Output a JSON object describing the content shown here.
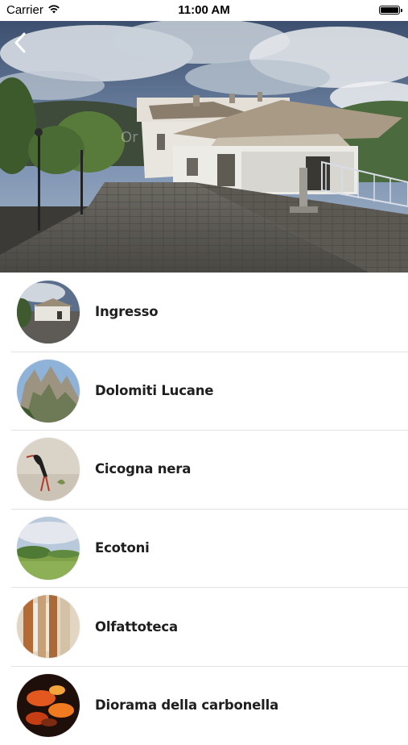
{
  "status_bar": {
    "carrier": "Carrier",
    "time": "11:00 AM",
    "icons": [
      "wifi-icon",
      "battery-icon"
    ]
  },
  "header": {
    "back_icon": "chevron-left-icon"
  },
  "items": [
    {
      "label": "Ingresso",
      "thumb": "building-photo"
    },
    {
      "label": "Dolomiti Lucane",
      "thumb": "mountain-photo"
    },
    {
      "label": "Cicogna nera",
      "thumb": "stork-photo"
    },
    {
      "label": "Ecotoni",
      "thumb": "meadow-photo"
    },
    {
      "label": "Olfattoteca",
      "thumb": "cabinet-photo"
    },
    {
      "label": "Diorama della carbonella",
      "thumb": "embers-photo"
    }
  ]
}
